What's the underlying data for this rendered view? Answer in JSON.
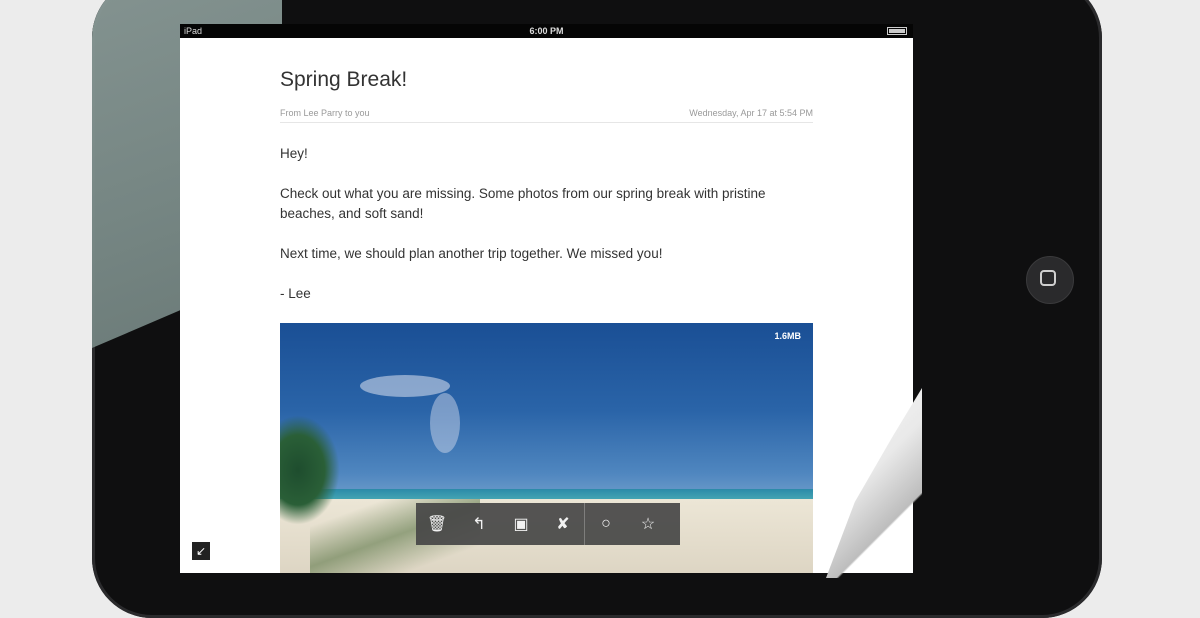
{
  "status_bar": {
    "device": "iPad",
    "time": "6:00 PM"
  },
  "email": {
    "subject": "Spring Break!",
    "from_line": "From Lee Parry to you",
    "date": "Wednesday, Apr 17 at 5:54 PM",
    "body": [
      "Hey!",
      "Check out what you are missing. Some photos from our spring break with pristine beaches, and soft sand!",
      "Next time, we should plan another trip together. We missed you!",
      "- Lee"
    ],
    "attachment_size": "1.6MB"
  },
  "toolbar": {
    "delete_icon": "🗑",
    "reply_icon": "↰",
    "move_icon": "▣",
    "spam_icon": "✘",
    "mark_icon": "○",
    "star_icon": "☆"
  },
  "shrink_icon": "↙"
}
